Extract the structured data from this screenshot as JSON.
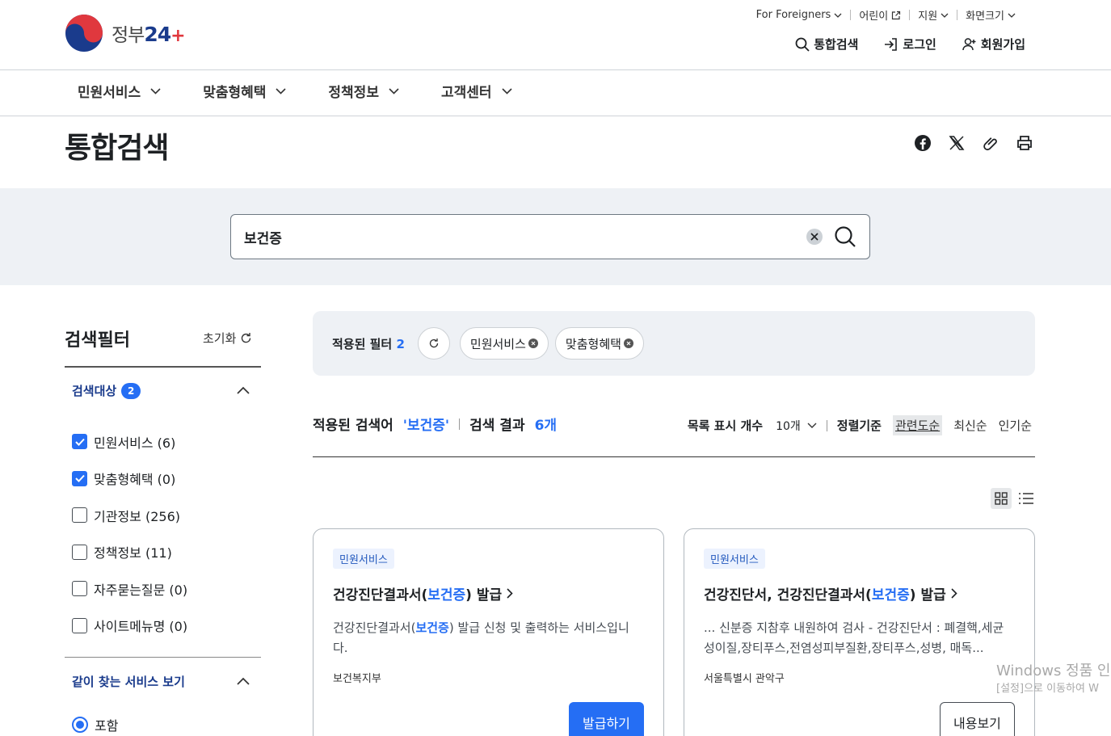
{
  "header": {
    "logo_text": "정부",
    "logo_num": "24",
    "util": [
      "For Foreigners",
      "어린이",
      "지원",
      "화면크기"
    ],
    "user": {
      "search": "통합검색",
      "login": "로그인",
      "signup": "회원가입"
    }
  },
  "main_nav": [
    "민원서비스",
    "맞춤형혜택",
    "정책정보",
    "고객센터"
  ],
  "page_title": "통합검색",
  "search": {
    "value": "보건증"
  },
  "filter": {
    "title": "검색필터",
    "reset": "초기화",
    "target": {
      "title": "검색대상",
      "count": "2"
    },
    "items": [
      {
        "label": "민원서비스 (6)",
        "checked": true
      },
      {
        "label": "맞춤형혜택 (0)",
        "checked": true
      },
      {
        "label": "기관정보 (256)",
        "checked": false
      },
      {
        "label": "정책정보 (11)",
        "checked": false
      },
      {
        "label": "자주묻는질문 (0)",
        "checked": false
      },
      {
        "label": "사이트메뉴명 (0)",
        "checked": false
      }
    ],
    "related": {
      "title": "같이 찾는 서비스 보기",
      "option": "포함"
    }
  },
  "applied": {
    "label": "적용된 필터",
    "count": "2",
    "chips": [
      "민원서비스",
      "맞춤형혜택"
    ]
  },
  "summary": {
    "term_label": "적용된 검색어",
    "term": "'보건증'",
    "result_label": "검색 결과",
    "result_count": "6개",
    "list_count_label": "목록 표시 개수",
    "list_count": "10개",
    "sort_label": "정렬기준",
    "sort_options": [
      "관련도순",
      "최신순",
      "인기순"
    ]
  },
  "cards": [
    {
      "tag": "민원서비스",
      "title_pre": "건강진단결과서(",
      "title_hl": "보건증",
      "title_post": ") 발급",
      "desc_pre": "건강진단결과서(",
      "desc_hl": "보건증",
      "desc_post": ") 발급 신청 및 출력하는 서비스입니다.",
      "org": "보건복지부",
      "button": "발급하기"
    },
    {
      "tag": "민원서비스",
      "title_pre": "건강진단서, 건강진단결과서(",
      "title_hl": "보건증",
      "title_post": ") 발급",
      "desc_pre": "... 신분증 지참후 내원하여 검사 - 건강진단서 : 폐결핵,세균성이질,장티푸스,전염성피부질환,장티푸스,성병, 매독...",
      "desc_hl": "",
      "desc_post": "",
      "org": "서울특별시 관악구",
      "button": "내용보기"
    }
  ],
  "watermark": {
    "line1": "Windows 정품 인",
    "line2": "[설정]으로 이동하여 W"
  }
}
